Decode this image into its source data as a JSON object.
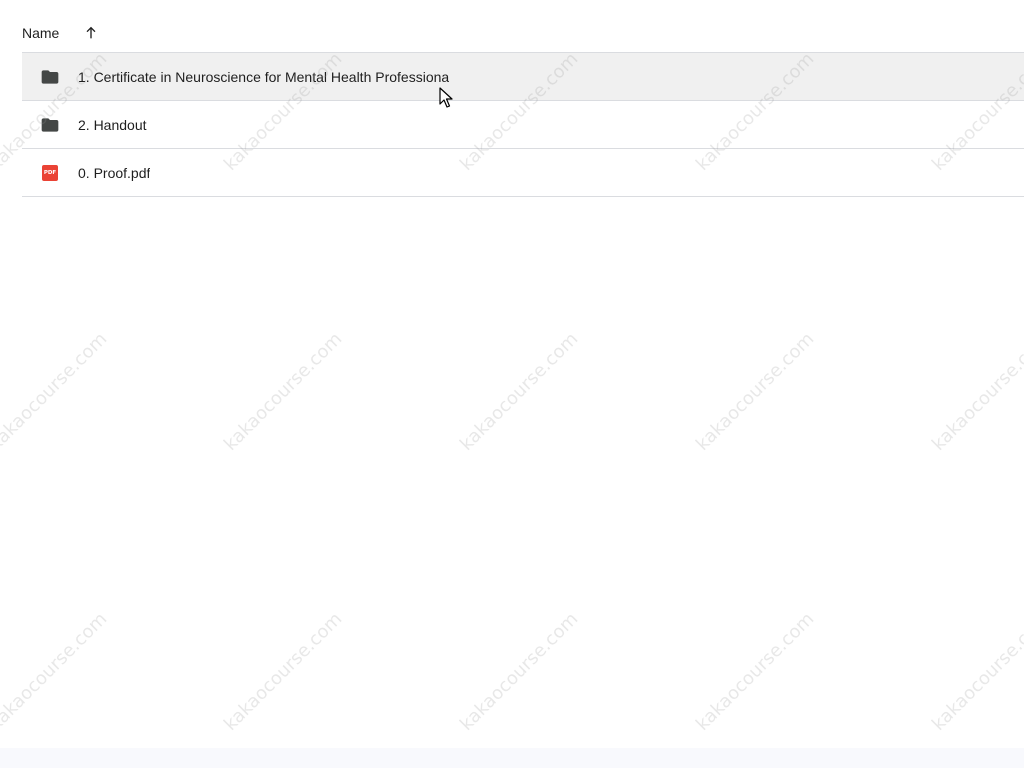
{
  "list_header": {
    "name_label": "Name",
    "sort_icon": "arrow-upward-icon"
  },
  "files": [
    {
      "name": "1. Certificate in Neuroscience for Mental Health Professiona",
      "type": "folder",
      "icon": "folder-icon",
      "hovered": true
    },
    {
      "name": "2. Handout",
      "type": "folder",
      "icon": "folder-icon",
      "hovered": false
    },
    {
      "name": "0. Proof.pdf",
      "type": "pdf",
      "icon": "pdf-icon",
      "badge": "PDF",
      "hovered": false
    }
  ],
  "watermark": "kakaocourse.com",
  "colors": {
    "folder": "#444746",
    "pdf": "#ea4335",
    "hover_row": "#f0f0f0",
    "divider": "#dadce0"
  }
}
